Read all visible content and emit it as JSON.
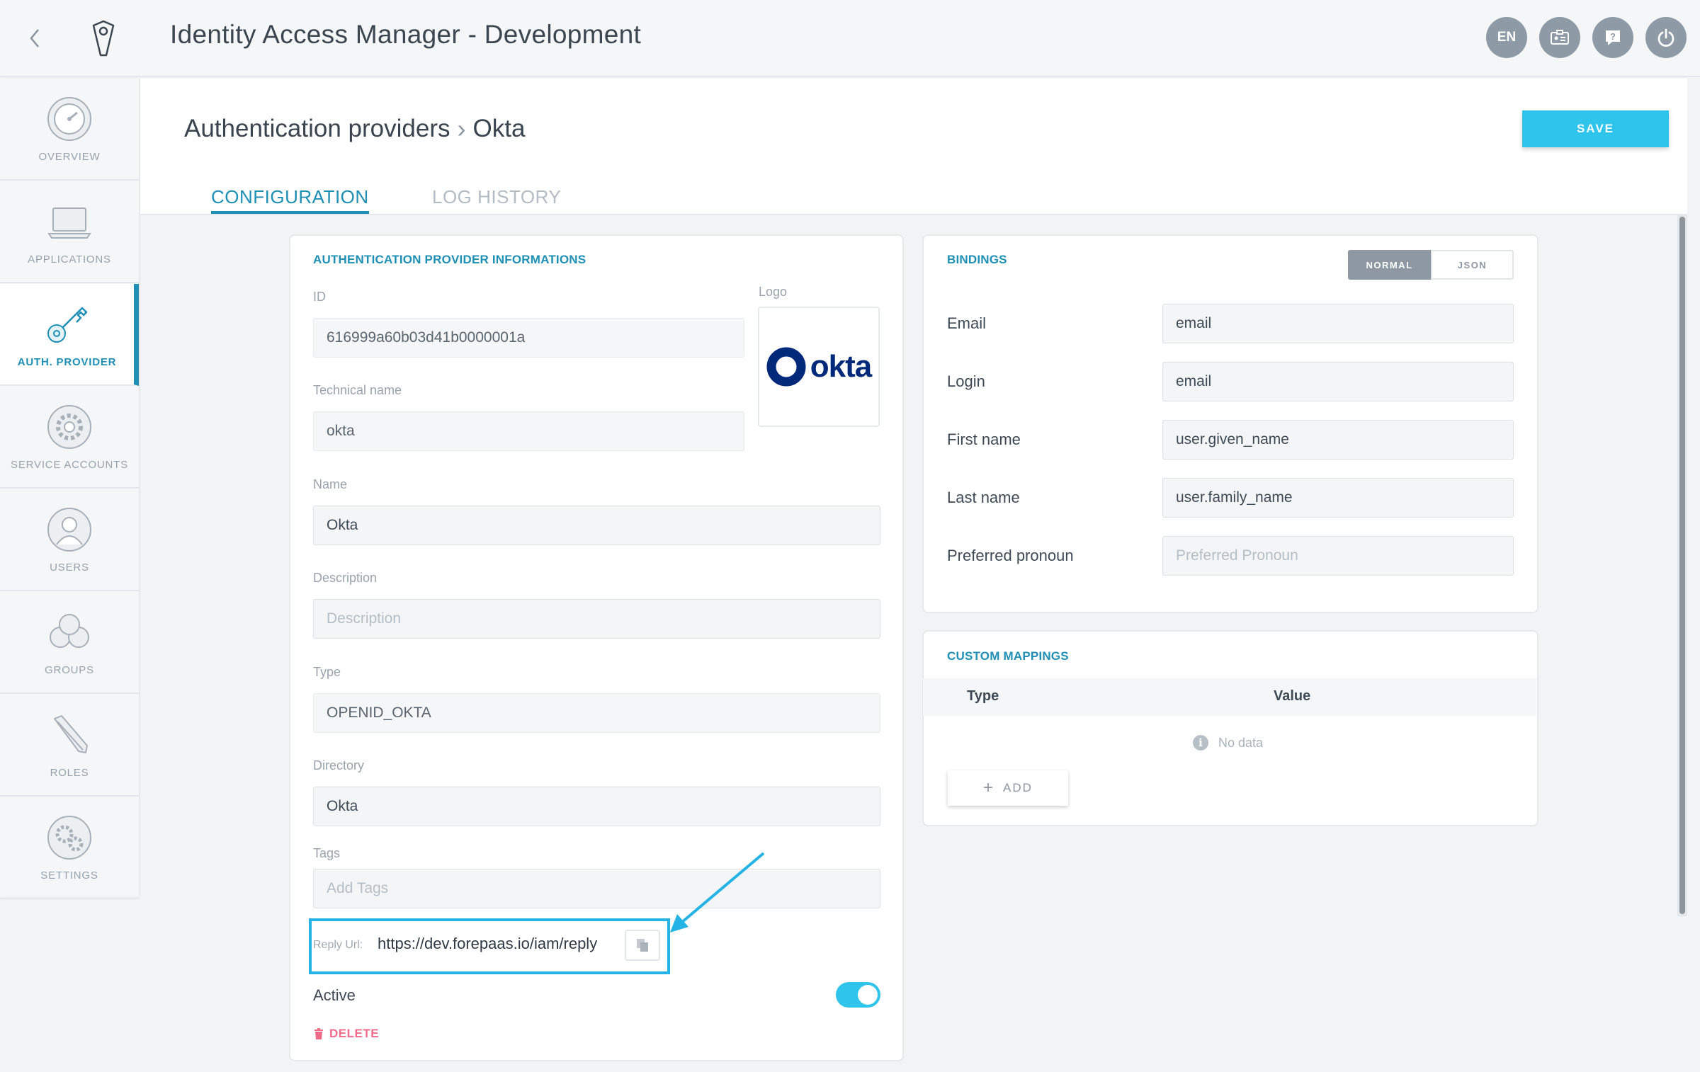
{
  "header": {
    "title": "Identity Access Manager - Development",
    "lang_label": "EN"
  },
  "sidebar": {
    "items": [
      {
        "label": "OVERVIEW",
        "icon": "gauge-icon"
      },
      {
        "label": "APPLICATIONS",
        "icon": "laptop-icon"
      },
      {
        "label": "AUTH. PROVIDER",
        "icon": "key-icon",
        "active": true
      },
      {
        "label": "SERVICE ACCOUNTS",
        "icon": "gears-icon"
      },
      {
        "label": "USERS",
        "icon": "user-icon"
      },
      {
        "label": "GROUPS",
        "icon": "group-icon"
      },
      {
        "label": "ROLES",
        "icon": "pencil-icon"
      },
      {
        "label": "SETTINGS",
        "icon": "settings-icon"
      }
    ]
  },
  "page": {
    "breadcrumb_parent": "Authentication providers",
    "breadcrumb_current": "Okta",
    "save_label": "SAVE",
    "tabs": [
      {
        "label": "CONFIGURATION",
        "active": true
      },
      {
        "label": "LOG HISTORY",
        "active": false
      }
    ]
  },
  "provider_info": {
    "title": "AUTHENTICATION PROVIDER INFORMATIONS",
    "id_label": "ID",
    "id_value": "616999a60b03d41b0000001a",
    "logo_label": "Logo",
    "logo_text": "okta",
    "technical_name_label": "Technical name",
    "technical_name_value": "okta",
    "name_label": "Name",
    "name_value": "Okta",
    "description_label": "Description",
    "description_placeholder": "Description",
    "type_label": "Type",
    "type_value": "OPENID_OKTA",
    "directory_label": "Directory",
    "directory_value": "Okta",
    "tags_label": "Tags",
    "tags_placeholder": "Add Tags",
    "reply_url_label": "Reply Url:",
    "reply_url_value": "https://dev.forepaas.io/iam/reply",
    "active_label": "Active",
    "active_value": true,
    "delete_label": "DELETE"
  },
  "bindings": {
    "title": "BINDINGS",
    "mode_normal": "NORMAL",
    "mode_json": "JSON",
    "rows": [
      {
        "label": "Email",
        "value": "email"
      },
      {
        "label": "Login",
        "value": "email"
      },
      {
        "label": "First name",
        "value": "user.given_name"
      },
      {
        "label": "Last name",
        "value": "user.family_name"
      },
      {
        "label": "Preferred pronoun",
        "placeholder": "Preferred Pronoun"
      }
    ]
  },
  "custom_mappings": {
    "title": "CUSTOM MAPPINGS",
    "col_type": "Type",
    "col_value": "Value",
    "empty_text": "No data",
    "add_label": "ADD"
  },
  "colors": {
    "accent": "#2ec4ec",
    "primary_text_blue": "#1e8fb5",
    "danger": "#f06a8a"
  }
}
